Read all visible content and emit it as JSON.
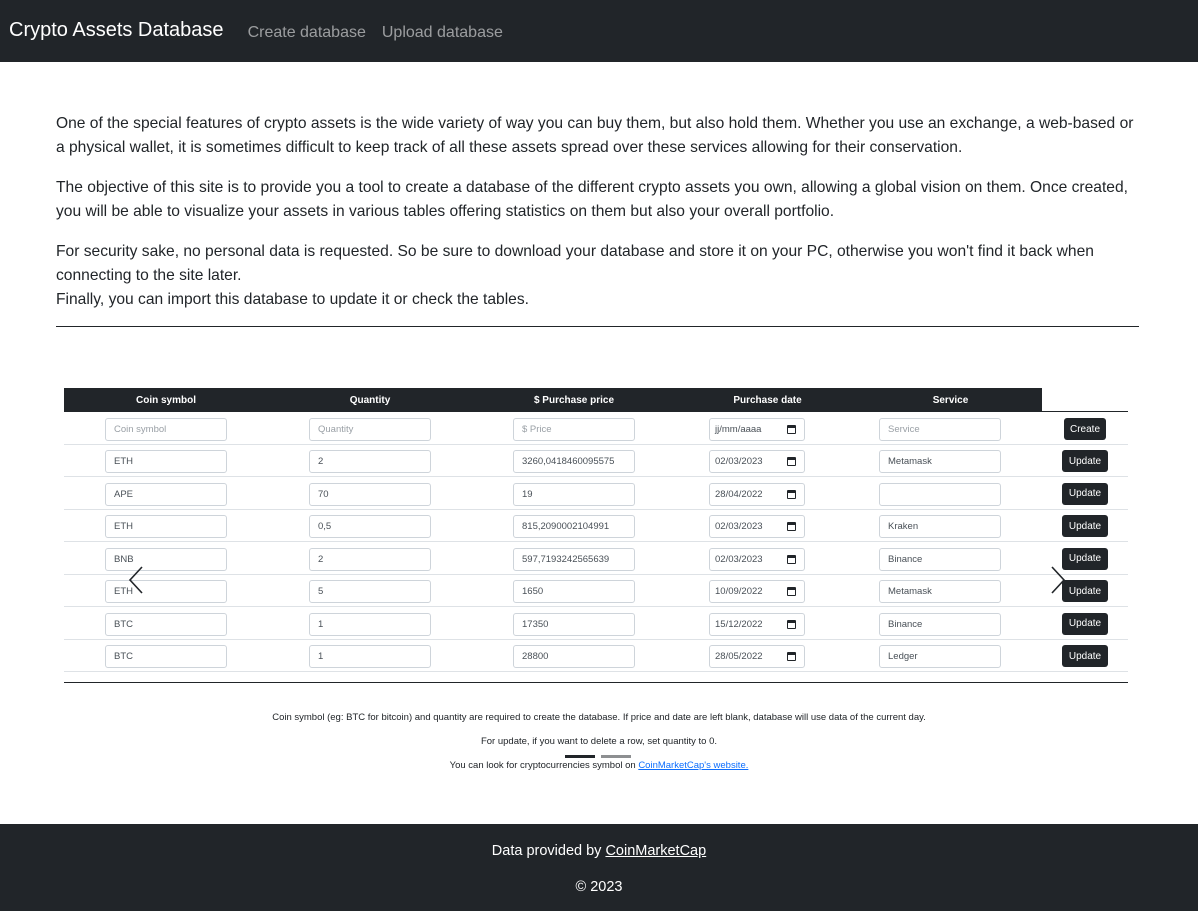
{
  "nav": {
    "brand": "Crypto Assets Database",
    "links": [
      "Create database",
      "Upload database"
    ]
  },
  "intro": {
    "p1": "One of the special features of crypto assets is the wide variety of way you can buy them, but also hold them. Whether you use an exchange, a web-based or a physical wallet, it is sometimes difficult to keep track of all these assets spread over these services allowing for their conservation.",
    "p2": "The objective of this site is to provide you a tool to create a database of the different crypto assets you own, allowing a global vision on them. Once created, you will be able to visualize your assets in various tables offering statistics on them but also your overall portfolio.",
    "p3a": "For security sake, no personal data is requested. So be sure to download your database and store it on your PC, otherwise you won't find it back when connecting to the site later.",
    "p3b": "Finally, you can import this database to update it or check the tables."
  },
  "table": {
    "headers": [
      "Coin symbol",
      "Quantity",
      "$ Purchase price",
      "Purchase date",
      "Service"
    ],
    "create_row": {
      "symbol_placeholder": "Coin symbol",
      "quantity_placeholder": "Quantity",
      "price_placeholder": "$ Price",
      "date_placeholder": "jj/mm/aaaa",
      "service_placeholder": "Service",
      "button": "Create"
    },
    "update_button": "Update",
    "rows": [
      {
        "symbol": "ETH",
        "quantity": "2",
        "price": "3260,0418460095575",
        "date": "02/03/2023",
        "service": "Metamask"
      },
      {
        "symbol": "APE",
        "quantity": "70",
        "price": "19",
        "date": "28/04/2022",
        "service": ""
      },
      {
        "symbol": "ETH",
        "quantity": "0,5",
        "price": "815,2090002104991",
        "date": "02/03/2023",
        "service": "Kraken"
      },
      {
        "symbol": "BNB",
        "quantity": "2",
        "price": "597,7193242565639",
        "date": "02/03/2023",
        "service": "Binance"
      },
      {
        "symbol": "ETH",
        "quantity": "5",
        "price": "1650",
        "date": "10/09/2022",
        "service": "Metamask"
      },
      {
        "symbol": "BTC",
        "quantity": "1",
        "price": "17350",
        "date": "15/12/2022",
        "service": "Binance"
      },
      {
        "symbol": "BTC",
        "quantity": "1",
        "price": "28800",
        "date": "28/05/2022",
        "service": "Ledger"
      }
    ]
  },
  "carousel": {
    "slide_count": 2,
    "active_slide": 1
  },
  "notes": {
    "line1": "Coin symbol (eg: BTC for bitcoin) and quantity are required to create the database. If price and date are left blank, database will use data of the current day.",
    "line2": "For update, if you want to delete a row, set quantity to 0.",
    "line3_prefix": "You can look for cryptocurrencies symbol on ",
    "line3_link": "CoinMarketCap's website."
  },
  "footer": {
    "prefix": "Data provided by ",
    "link": "CoinMarketCap",
    "copyright": "© 2023"
  },
  "colors": {
    "dark": "#212529",
    "link": "#0d6efd"
  }
}
